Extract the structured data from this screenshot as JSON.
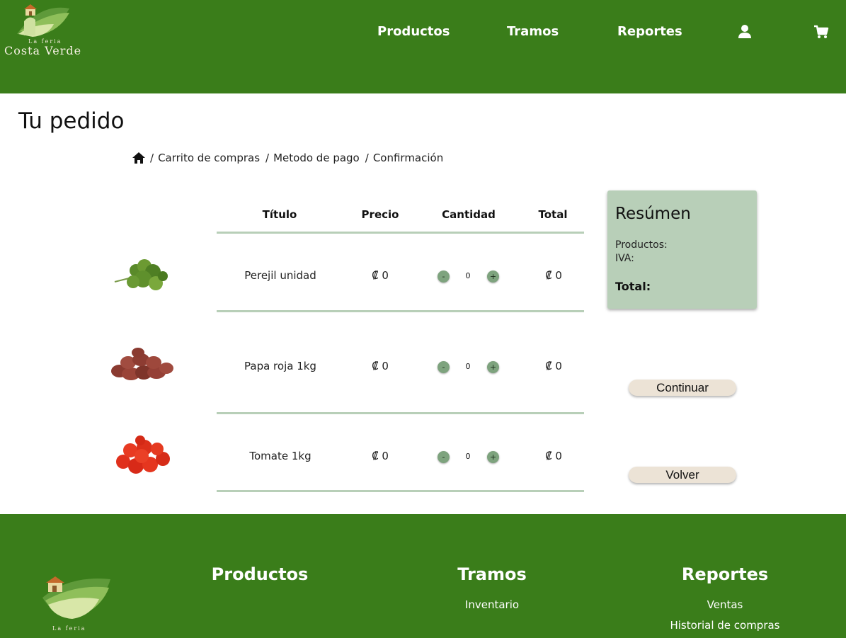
{
  "brand": {
    "tagline": "La feria",
    "name": "Costa Verde"
  },
  "nav": {
    "links": [
      "Productos",
      "Tramos",
      "Reportes"
    ],
    "icons": [
      "user-icon",
      "cart-icon"
    ]
  },
  "page": {
    "title": "Tu pedido"
  },
  "breadcrumb": {
    "home_icon": "home-icon",
    "separator": "/",
    "items": [
      "Carrito de compras",
      "Metodo de pago",
      "Confirmación"
    ]
  },
  "table": {
    "headers": [
      "Título",
      "Precio",
      "Cantidad",
      "Total"
    ],
    "rows": [
      {
        "image": "parsley-image",
        "title": "Perejil unidad",
        "price": "₡ 0",
        "quantity": "0",
        "total": "₡ 0",
        "minus": "-",
        "plus": "+"
      },
      {
        "image": "red-potatoes-image",
        "title": "Papa roja 1kg",
        "price": "₡ 0",
        "quantity": "0",
        "total": "₡ 0",
        "minus": "-",
        "plus": "+"
      },
      {
        "image": "tomatoes-image",
        "title": "Tomate 1kg",
        "price": "₡ 0",
        "quantity": "0",
        "total": "₡ 0",
        "minus": "-",
        "plus": "+"
      }
    ]
  },
  "summary": {
    "title": "Resúmen",
    "products_label": "Productos:",
    "iva_label": "IVA:",
    "total_label": "Total:"
  },
  "actions": {
    "continue_label": "Continuar",
    "back_label": "Volver"
  },
  "footer": {
    "columns": [
      {
        "heading": "Productos",
        "links": []
      },
      {
        "heading": "Tramos",
        "links": [
          "Inventario"
        ]
      },
      {
        "heading": "Reportes",
        "links": [
          "Ventas",
          "Historial de compras"
        ]
      }
    ],
    "logo_text": "La feria"
  },
  "colors": {
    "primary_green": "#3a7d1a",
    "accent_light_green": "#b8cfb8",
    "button_beige": "#ece3d6",
    "qty_button_green": "#7ea37e"
  }
}
